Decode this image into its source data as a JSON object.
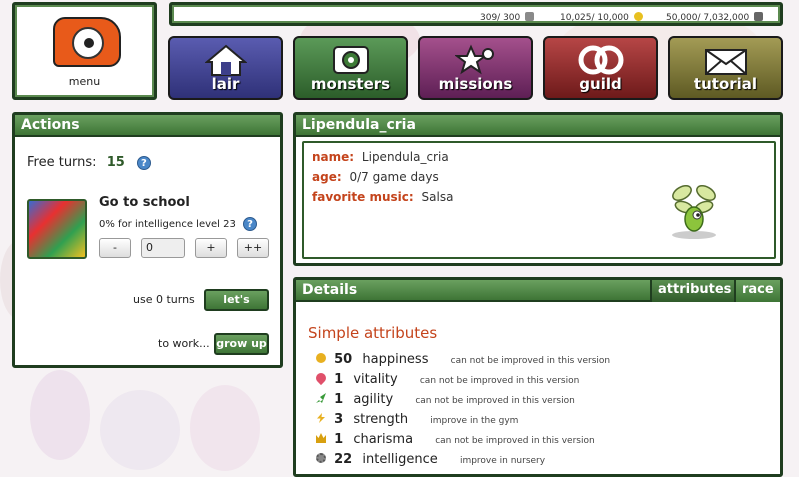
{
  "menu": {
    "label": "menu"
  },
  "status": {
    "energy": "309/ 300",
    "coins": "10,025/ 10,000",
    "gold": "50,000/ 7,032,000"
  },
  "nav": [
    {
      "label": "lair",
      "icon": "house-icon"
    },
    {
      "label": "monsters",
      "icon": "monster-eye-icon"
    },
    {
      "label": "missions",
      "icon": "star-gear-icon"
    },
    {
      "label": "guild",
      "icon": "rings-icon"
    },
    {
      "label": "tutorial",
      "icon": "envelope-icon"
    }
  ],
  "actions": {
    "title": "Actions",
    "free_turns_label": "Free turns:",
    "free_turns_value": "15",
    "activity_title": "Go to school",
    "activity_desc": "0% for intelligence level 23",
    "minus": "-",
    "turn_value": "0",
    "plus": "+",
    "plusplus": "++",
    "use_turns": "use 0 turns",
    "lets_play": "let's play!",
    "to_work": "to work...",
    "grow_up": "grow up"
  },
  "profile": {
    "title": "Lipendula_cria",
    "name_label": "name:",
    "name_value": "Lipendula_cria",
    "age_label": "age:",
    "age_value": "0/7 game days",
    "music_label": "favorite music:",
    "music_value": "Salsa"
  },
  "details": {
    "title": "Details",
    "tabs": [
      "attributes",
      "race"
    ],
    "section": "Simple attributes",
    "attributes": [
      {
        "value": "50",
        "name": "happiness",
        "note": "can not be improved in this version",
        "color": "#e8b020"
      },
      {
        "value": "1",
        "name": "vitality",
        "note": "can not be improved in this version",
        "color": "#e0506a"
      },
      {
        "value": "1",
        "name": "agility",
        "note": "can not be improved in this version",
        "color": "#3a9a3a"
      },
      {
        "value": "3",
        "name": "strength",
        "note": "improve in the gym",
        "color": "#e8b020"
      },
      {
        "value": "1",
        "name": "charisma",
        "note": "can not be improved in this version",
        "color": "#d8a010"
      },
      {
        "value": "22",
        "name": "intelligence",
        "note": "improve in nursery",
        "color": "#888888"
      }
    ]
  }
}
